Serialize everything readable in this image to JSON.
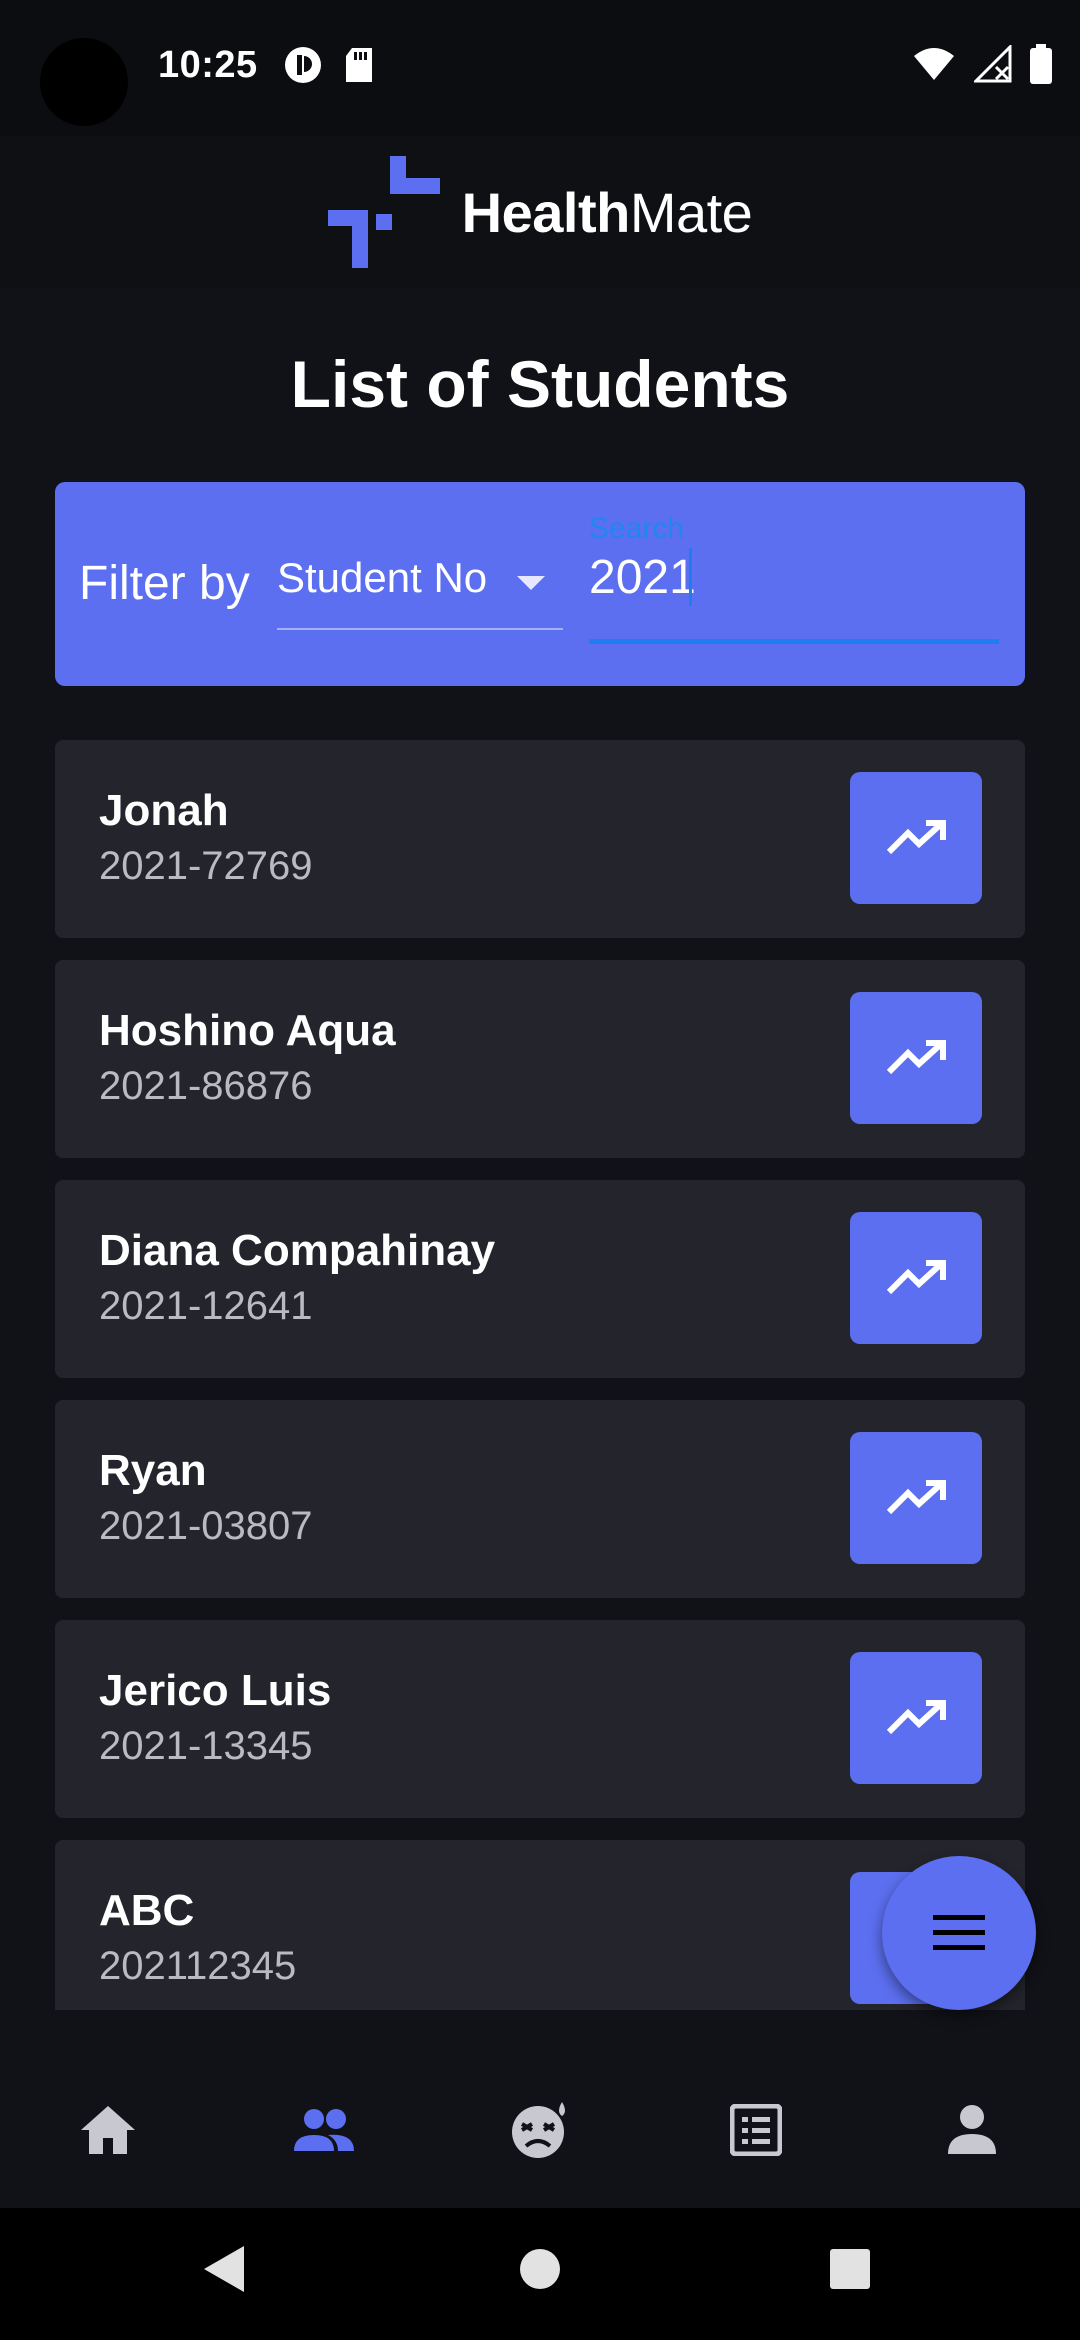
{
  "status_bar": {
    "time": "10:25"
  },
  "header": {
    "brand_bold": "Health",
    "brand_light": "Mate"
  },
  "page_title": "List of Students",
  "filter": {
    "label": "Filter by",
    "selected": "Student No",
    "search_label": "Search",
    "search_value": "2021"
  },
  "students": [
    {
      "name": "Jonah",
      "student_no": "2021-72769"
    },
    {
      "name": "Hoshino Aqua",
      "student_no": "2021-86876"
    },
    {
      "name": "Diana Compahinay",
      "student_no": "2021-12641"
    },
    {
      "name": "Ryan",
      "student_no": "2021-03807"
    },
    {
      "name": "Jerico Luis",
      "student_no": "2021-13345"
    },
    {
      "name": "ABC",
      "student_no": "202112345"
    }
  ],
  "bottom_nav": {
    "items": [
      {
        "icon": "home-icon",
        "active": false
      },
      {
        "icon": "people-icon",
        "active": true
      },
      {
        "icon": "sick-face-icon",
        "active": false
      },
      {
        "icon": "list-icon",
        "active": false
      },
      {
        "icon": "person-icon",
        "active": false
      }
    ]
  },
  "colors": {
    "accent": "#5c6ff0",
    "search_focus": "#1e7ef0",
    "card": "#24252c",
    "background": "#111217"
  }
}
